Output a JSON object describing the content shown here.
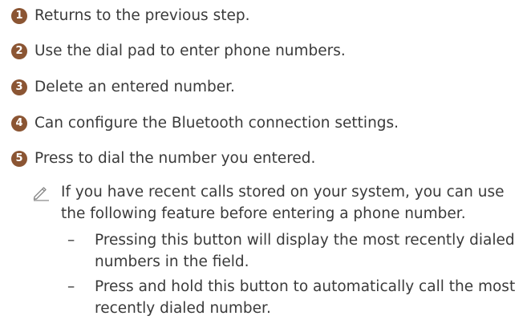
{
  "steps": [
    {
      "number": "1",
      "text": "Returns to the previous step."
    },
    {
      "number": "2",
      "text": "Use the dial pad to enter phone numbers."
    },
    {
      "number": "3",
      "text": "Delete an entered number."
    },
    {
      "number": "4",
      "text": "Can configure the Bluetooth connection settings."
    },
    {
      "number": "5",
      "text": "Press to dial the number you entered."
    }
  ],
  "note": {
    "icon": "pencil-icon",
    "text": "If you have recent calls stored on your system, you can use the following feature before entering a phone number.",
    "bullets": [
      {
        "dash": "–",
        "text": "Pressing this button will display the most recently dialed numbers in the field."
      },
      {
        "dash": "–",
        "text": "Press and hold this button to automatically call the most recently dialed number."
      }
    ]
  },
  "colors": {
    "badge": "#8b5533",
    "text": "#3a3a3a",
    "icon": "#8a8a8a"
  }
}
